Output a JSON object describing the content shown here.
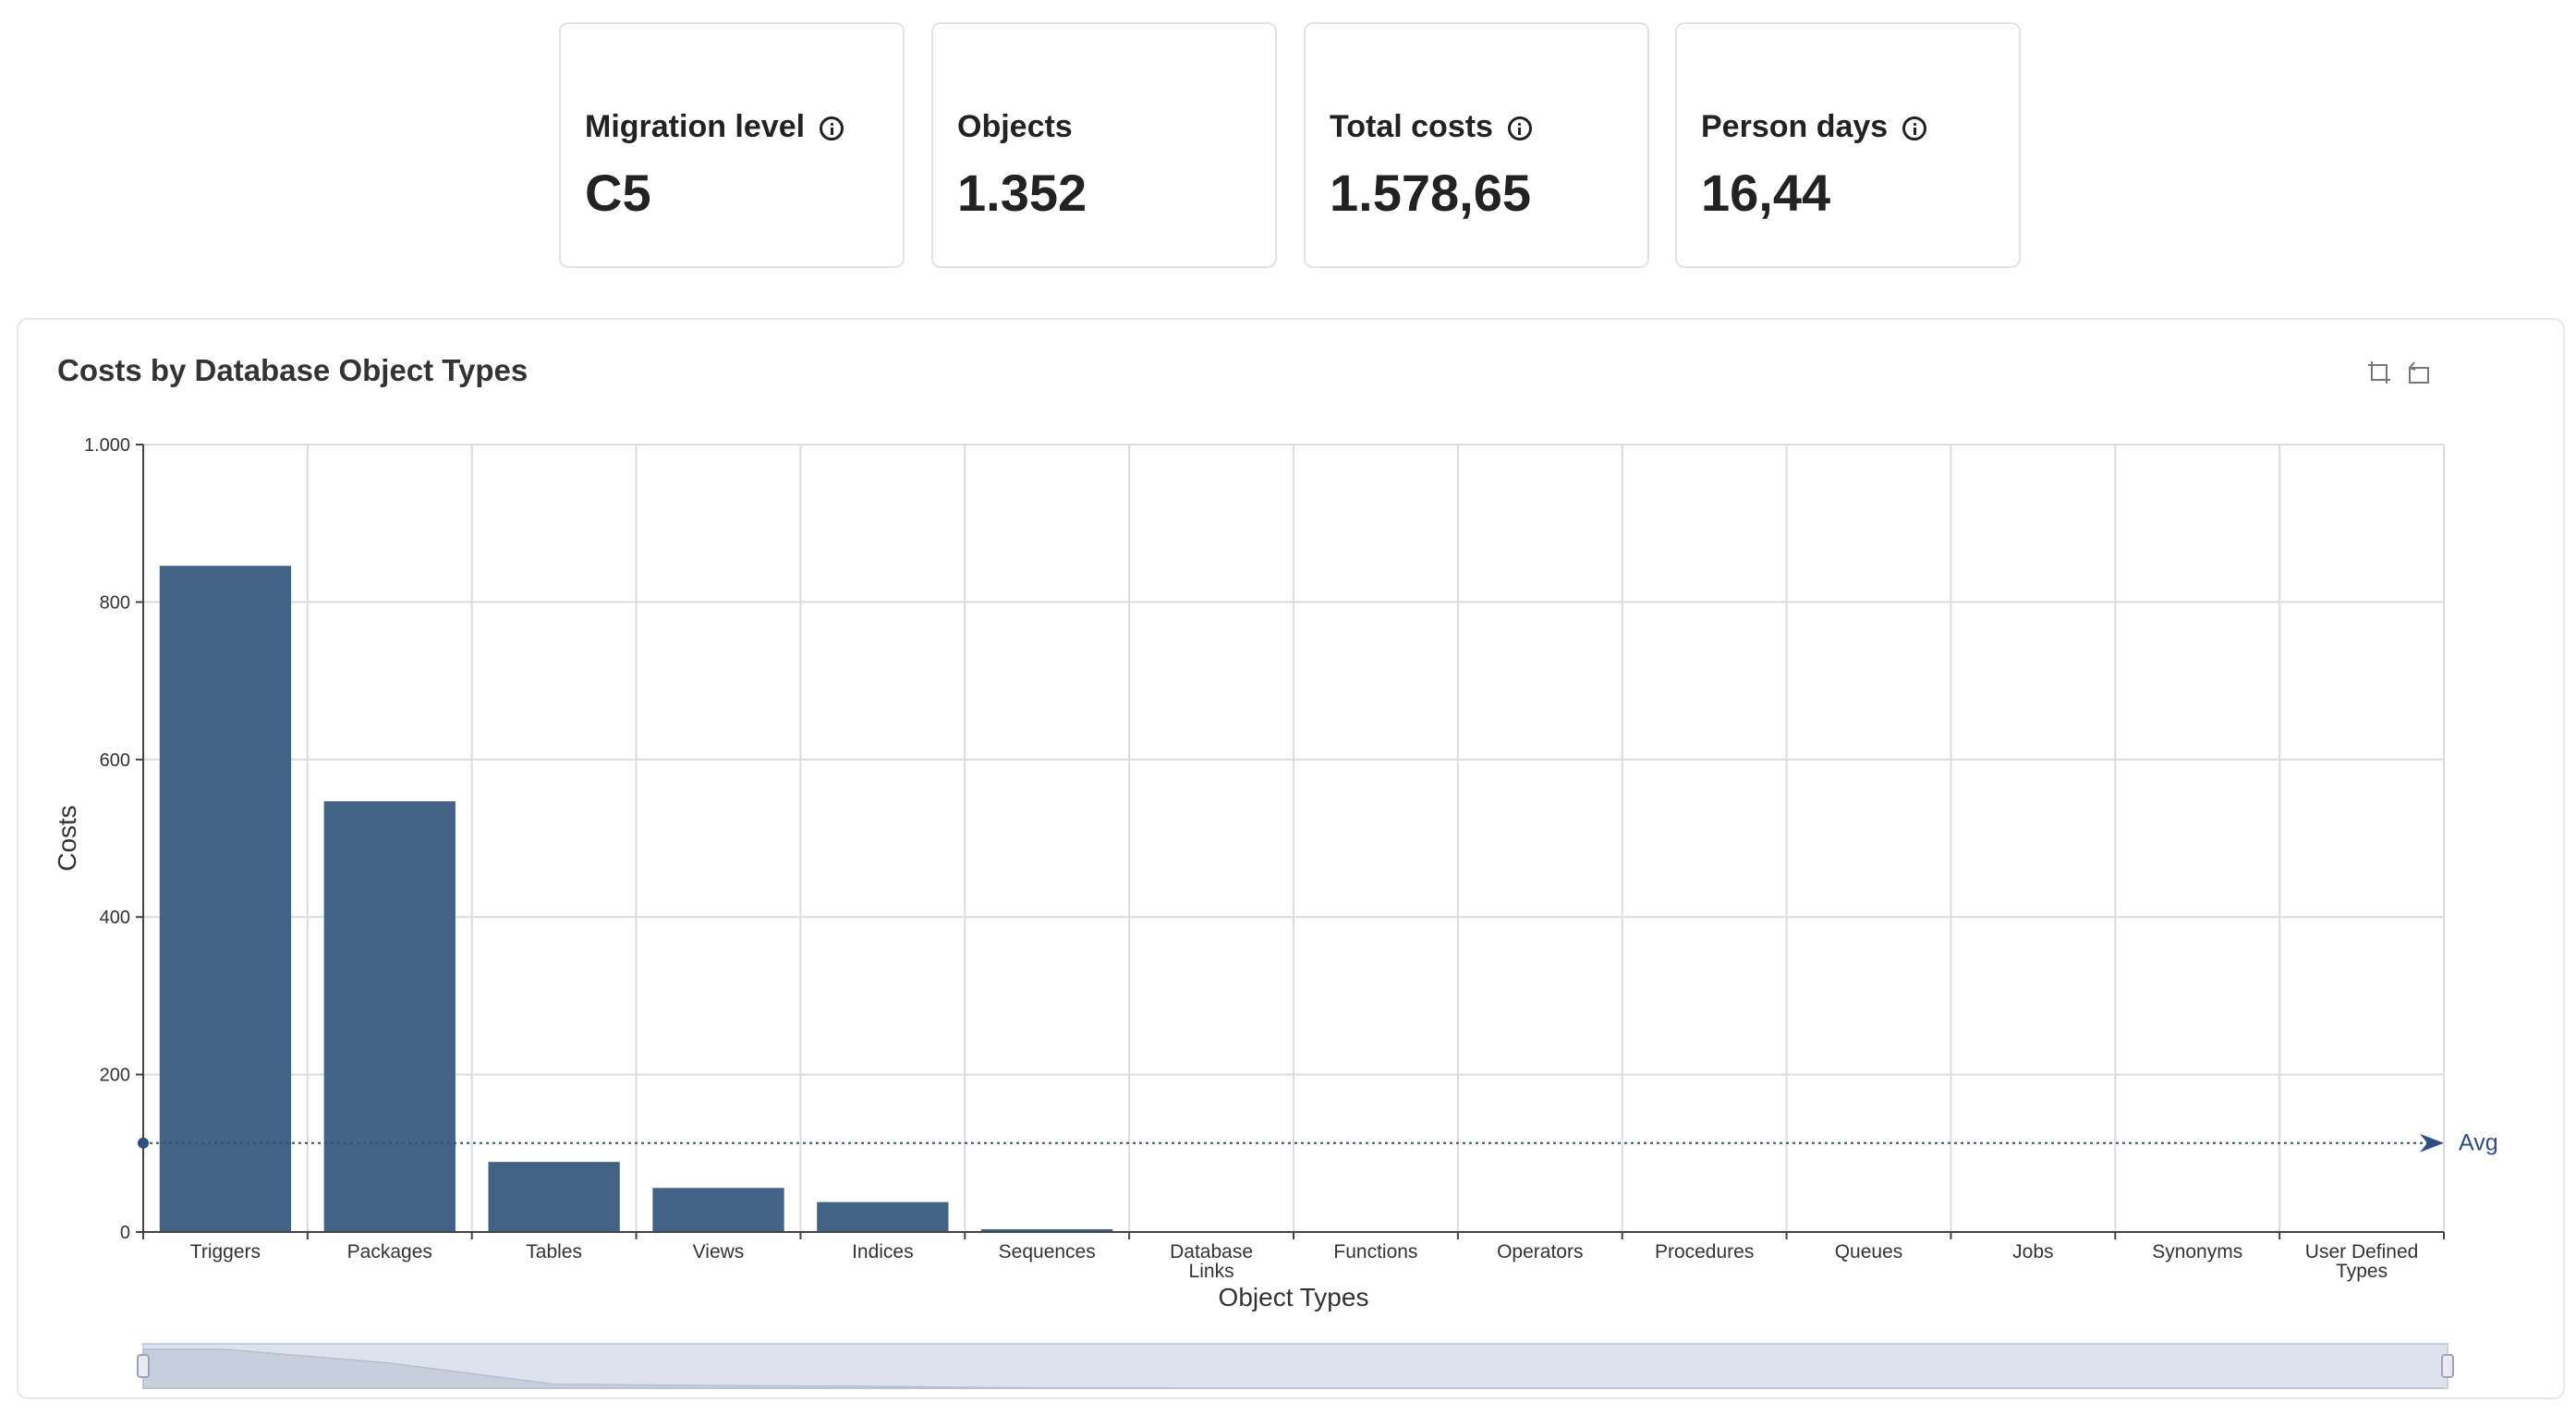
{
  "kpis": [
    {
      "label": "Migration level",
      "value": "C5",
      "info_icon": "info-circle-icon"
    },
    {
      "label": "Objects",
      "value": "1.352"
    },
    {
      "label": "Total costs",
      "value": "1.578,65",
      "info_icon": "info-circle-icon"
    },
    {
      "label": "Person days",
      "value": "16,44",
      "info_icon": "info-circle-icon"
    }
  ],
  "toolbar": {
    "icons": [
      "zoom-select-icon",
      "zoom-reset-icon"
    ]
  },
  "chart_data": {
    "type": "bar",
    "title": "Costs by Database Object Types",
    "xlabel": "Object Types",
    "ylabel": "Costs",
    "categories": [
      "Triggers",
      "Packages",
      "Tables",
      "Views",
      "Indices",
      "Sequences",
      "Database Links",
      "Functions",
      "Operators",
      "Procedures",
      "Queues",
      "Jobs",
      "Synonyms",
      "User Defined Types"
    ],
    "values": [
      846,
      547,
      89,
      56,
      38,
      3,
      0,
      0,
      0,
      0,
      0,
      0,
      0,
      0
    ],
    "ylim": [
      0,
      1000
    ],
    "yticks": [
      0,
      200,
      400,
      600,
      800,
      1000
    ],
    "ytick_labels": [
      "0",
      "200",
      "400",
      "600",
      "800",
      "1.000"
    ],
    "average": {
      "label": "Avg",
      "value": 113
    },
    "grid": true,
    "bar_color": "#426385",
    "has_zoom_slider": true
  }
}
